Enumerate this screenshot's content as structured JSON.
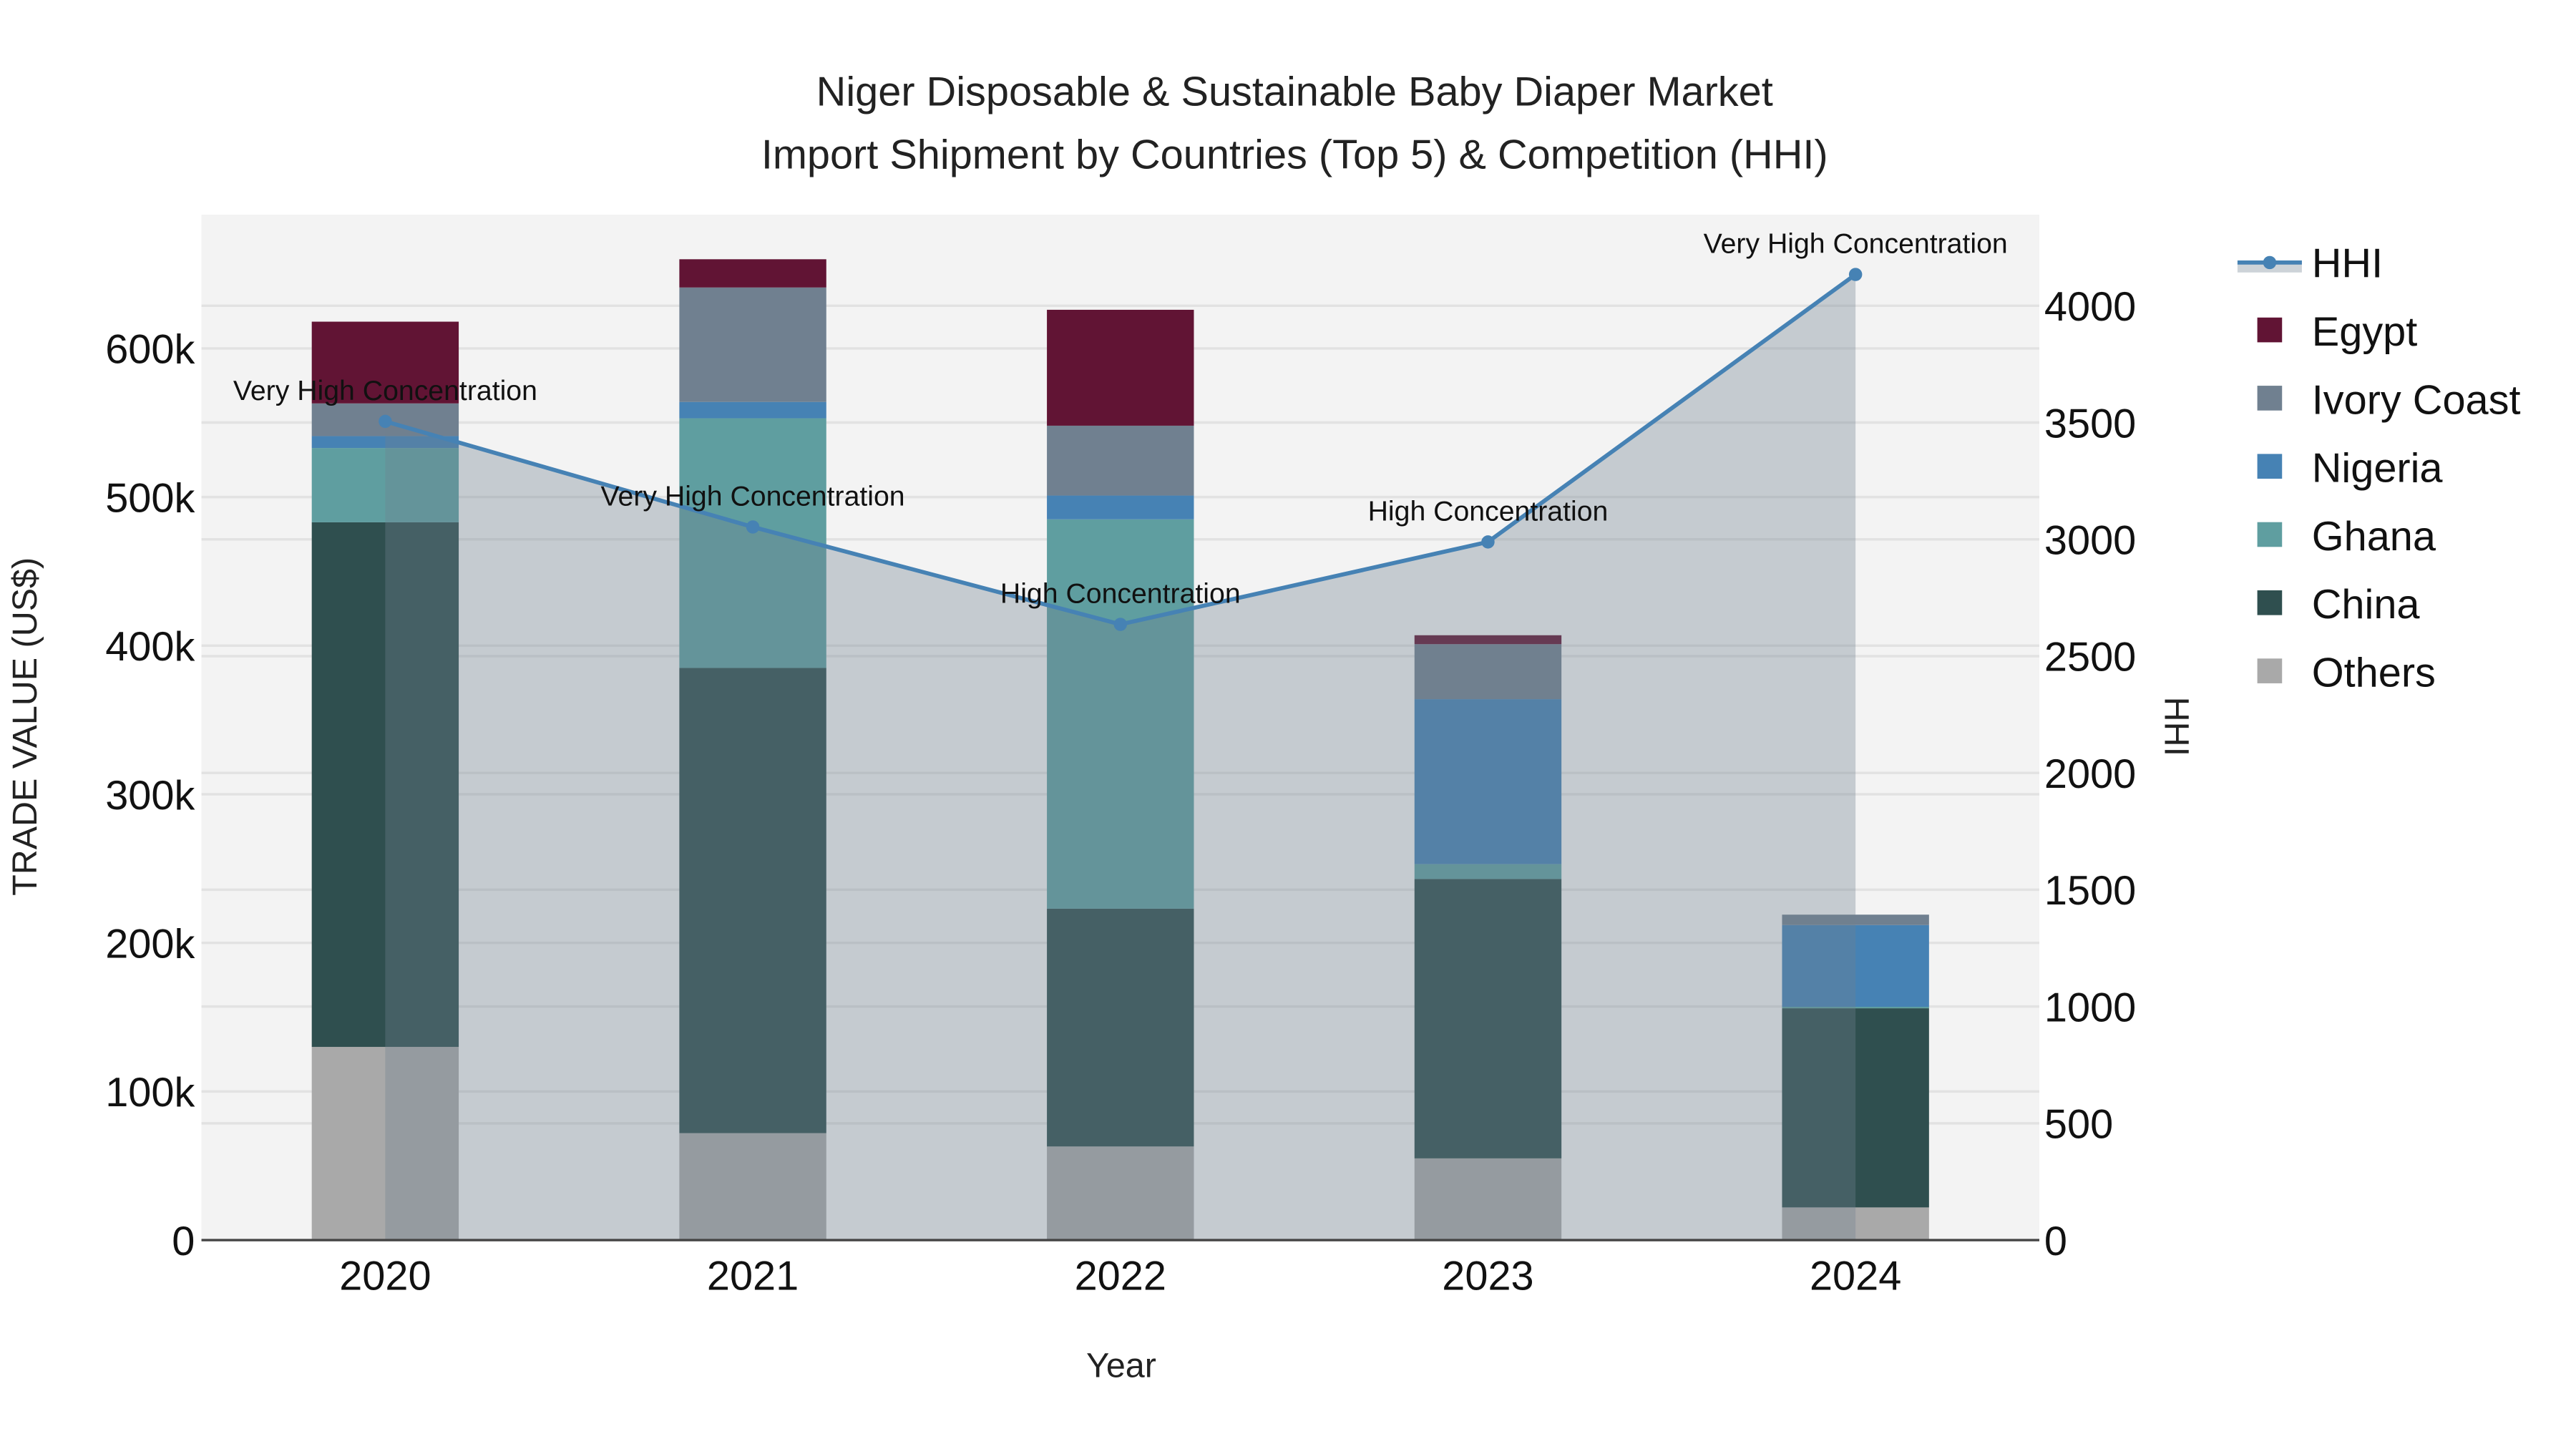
{
  "chart_data": {
    "type": "bar",
    "stacked": true,
    "title": [
      "Niger Disposable & Sustainable Baby Diaper Market",
      "Import Shipment by Countries (Top 5) & Competition (HHI)"
    ],
    "xlabel": "Year",
    "ylabel": "TRADE VALUE (US$)",
    "y2label": "HHI",
    "categories": [
      "2020",
      "2021",
      "2022",
      "2023",
      "2024"
    ],
    "ylim": [
      0,
      690000
    ],
    "y2lim": [
      0,
      4390
    ],
    "yticks": [
      {
        "v": 0,
        "label": "0"
      },
      {
        "v": 100000,
        "label": "100k"
      },
      {
        "v": 200000,
        "label": "200k"
      },
      {
        "v": 300000,
        "label": "300k"
      },
      {
        "v": 400000,
        "label": "400k"
      },
      {
        "v": 500000,
        "label": "500k"
      },
      {
        "v": 600000,
        "label": "600k"
      }
    ],
    "y2ticks": [
      {
        "v": 0,
        "label": "0"
      },
      {
        "v": 500,
        "label": "500"
      },
      {
        "v": 1000,
        "label": "1000"
      },
      {
        "v": 1500,
        "label": "1500"
      },
      {
        "v": 2000,
        "label": "2000"
      },
      {
        "v": 2500,
        "label": "2500"
      },
      {
        "v": 3000,
        "label": "3000"
      },
      {
        "v": 3500,
        "label": "3500"
      },
      {
        "v": 4000,
        "label": "4000"
      }
    ],
    "series": [
      {
        "name": "Others",
        "color": "#a9a9a9",
        "values": [
          130000,
          72000,
          63000,
          55000,
          22000
        ]
      },
      {
        "name": "China",
        "color": "#2f4f4f",
        "values": [
          353000,
          313000,
          160000,
          188000,
          134000
        ]
      },
      {
        "name": "Ghana",
        "color": "#5f9ea0",
        "values": [
          50000,
          168000,
          262000,
          10000,
          1000
        ]
      },
      {
        "name": "Nigeria",
        "color": "#4682b4",
        "values": [
          8000,
          11000,
          16000,
          111000,
          55000
        ]
      },
      {
        "name": "Ivory Coast",
        "color": "#708090",
        "values": [
          22000,
          77000,
          47000,
          37000,
          7000
        ]
      },
      {
        "name": "Egypt",
        "color": "#611434",
        "values": [
          55000,
          19000,
          78000,
          6000,
          0
        ]
      }
    ],
    "line": {
      "name": "HHI",
      "color": "#4682b4",
      "axis": "right",
      "values": [
        3505,
        3053,
        2636,
        2989,
        4134
      ],
      "annotations": [
        "Very High Concentration",
        "Very High Concentration",
        "High Concentration",
        "High Concentration",
        "Very High Concentration"
      ]
    },
    "legend": {
      "placement": "right",
      "order": [
        "HHI",
        "Egypt",
        "Ivory Coast",
        "Nigeria",
        "Ghana",
        "China",
        "Others"
      ]
    },
    "grid": true
  }
}
